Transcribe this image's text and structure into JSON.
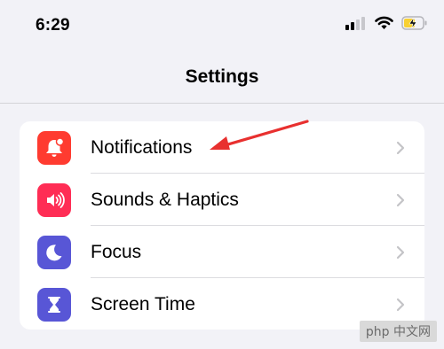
{
  "status_bar": {
    "time": "6:29",
    "icons": [
      "cellular-signal-icon",
      "wifi-icon",
      "battery-charging-icon"
    ]
  },
  "nav": {
    "title": "Settings"
  },
  "settings_rows": [
    {
      "label": "Notifications",
      "icon": "bell-icon",
      "color": "#ff3b30"
    },
    {
      "label": "Sounds & Haptics",
      "icon": "speaker-icon",
      "color": "#ff2d55"
    },
    {
      "label": "Focus",
      "icon": "moon-icon",
      "color": "#5856d6"
    },
    {
      "label": "Screen Time",
      "icon": "hourglass-icon",
      "color": "#5856d6"
    }
  ],
  "annotation": {
    "icon": "red-arrow-icon",
    "color": "#e8302f"
  },
  "watermark": {
    "text": "php 中文网"
  }
}
